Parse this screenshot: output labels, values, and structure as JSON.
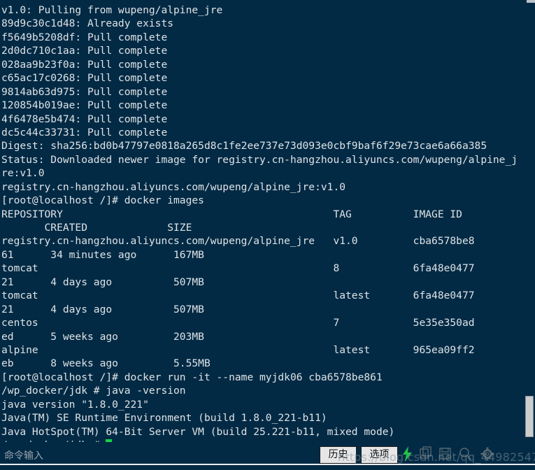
{
  "terminal": {
    "background_color": "#022a45",
    "text_color": "#dfe3e6",
    "cursor_color": "#16d44a",
    "lines": [
      "v1.0: Pulling from wupeng/alpine_jre",
      "89d9c30c1d48: Already exists",
      "f5649b5208df: Pull complete",
      "2d0dc710c1aa: Pull complete",
      "028aa9b23f0a: Pull complete",
      "c65ac17c0268: Pull complete",
      "9814ab63d975: Pull complete",
      "120854b019ae: Pull complete",
      "4f6478e5b474: Pull complete",
      "dc5c44c33731: Pull complete",
      "Digest: sha256:bd0b47797e0818a265d8c1fe2ee737e73d093e0cbf9baf6f29e73cae6a66a385",
      "Status: Downloaded newer image for registry.cn-hangzhou.aliyuncs.com/wupeng/alpine_j",
      "re:v1.0",
      "registry.cn-hangzhou.aliyuncs.com/wupeng/alpine_jre:v1.0",
      "[root@localhost /]# docker images",
      "REPOSITORY                                            TAG          IMAGE ID",
      "       CREATED             SIZE",
      "registry.cn-hangzhou.aliyuncs.com/wupeng/alpine_jre   v1.0         cba6578be8",
      "61      34 minutes ago      167MB",
      "tomcat                                                8            6fa48e0477",
      "21      4 days ago          507MB",
      "tomcat                                                latest       6fa48e0477",
      "21      4 days ago          507MB",
      "centos                                                7            5e35e350ad",
      "ed      5 weeks ago         203MB",
      "alpine                                                latest       965ea09ff2",
      "eb      8 weeks ago         5.55MB",
      "[root@localhost /]# docker run -it --name myjdk06 cba6578be861",
      "/wp_docker/jdk # java -version",
      "java version \"1.8.0_221\"",
      "Java(TM) SE Runtime Environment (build 1.8.0_221-b11)",
      "Java HotSpot(TM) 64-Bit Server VM (build 25.221-b11, mixed mode)"
    ],
    "prompt_line": "/wp_docker/jdk # "
  },
  "bottom_bar": {
    "input_placeholder": "命令输入",
    "input_value": "",
    "history_button_label": "历史",
    "options_button_label": "选项",
    "icons": {
      "bolt": "lightning-bolt-icon",
      "copy": "copy-icon",
      "save": "save-icon",
      "find": "search-icon",
      "gear": "gear-icon"
    },
    "dots": "......"
  },
  "watermark": {
    "text": "https://blog.csdn.net/qq_44982547"
  },
  "scrollbar": {
    "thumb_color": "#cdcdcd"
  }
}
